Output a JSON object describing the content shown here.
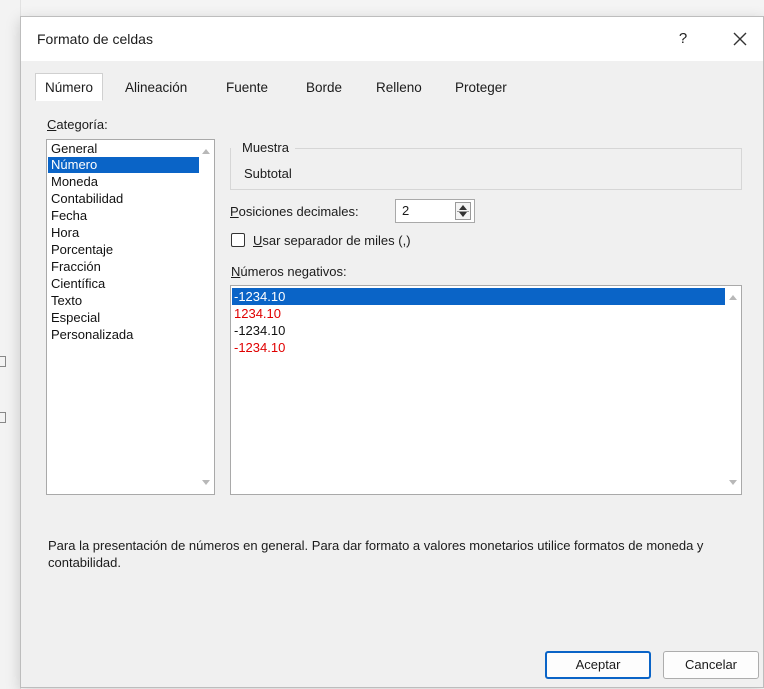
{
  "dialog": {
    "title": "Formato de celdas",
    "help_glyph": "?",
    "close_glyph": "✕"
  },
  "tabs": [
    {
      "label": "Número",
      "active": true
    },
    {
      "label": "Alineación",
      "active": false
    },
    {
      "label": "Fuente",
      "active": false
    },
    {
      "label": "Borde",
      "active": false
    },
    {
      "label": "Relleno",
      "active": false
    },
    {
      "label": "Proteger",
      "active": false
    }
  ],
  "category": {
    "label_first": "C",
    "label_rest": "ategoría:",
    "items": [
      "General",
      "Número",
      "Moneda",
      "Contabilidad",
      "Fecha",
      "Hora",
      "Porcentaje",
      "Fracción",
      "Científica",
      "Texto",
      "Especial",
      "Personalizada"
    ],
    "selected": "Número"
  },
  "sample": {
    "label": "Muestra",
    "value": "Subtotal"
  },
  "decimals": {
    "label_first": "P",
    "label_rest": "osiciones decimales:",
    "value": "2"
  },
  "thousands": {
    "label_first": "U",
    "label_mid": "sar separador de miles (",
    "label_sep": ",",
    "label_end": ")",
    "checked": false
  },
  "negatives": {
    "label_first": "N",
    "label_rest": "úmeros negativos:",
    "items": [
      {
        "text": "-1234.10",
        "color": "#111111",
        "selected": true
      },
      {
        "text": "1234.10",
        "color": "#e00000",
        "selected": false
      },
      {
        "text": "-1234.10",
        "color": "#111111",
        "selected": false
      },
      {
        "text": "-1234.10",
        "color": "#e00000",
        "selected": false
      }
    ]
  },
  "description": "Para la presentación de números en general. Para dar formato a valores monetarios utilice formatos de moneda y contabilidad.",
  "buttons": {
    "ok": "Aceptar",
    "cancel": "Cancelar"
  },
  "colors": {
    "selection": "#0a64c7",
    "negative_red": "#e00000",
    "dialog_bg": "#f0f0f0"
  }
}
